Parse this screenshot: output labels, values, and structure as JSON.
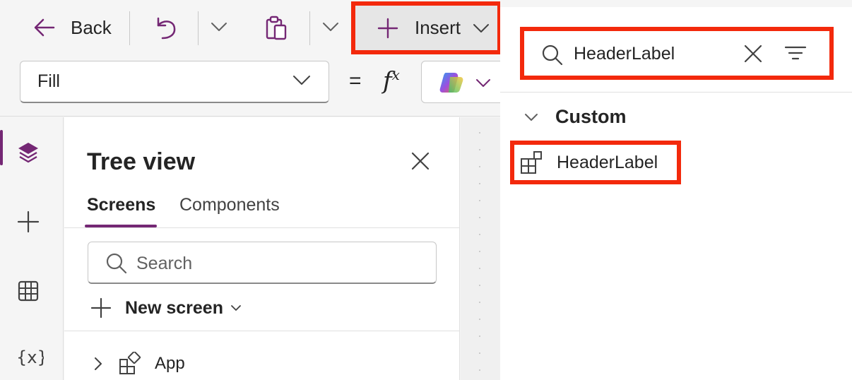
{
  "command_bar": {
    "back_label": "Back",
    "insert_label": "Insert"
  },
  "formula_bar": {
    "property": "Fill",
    "equals": "=",
    "fx": "fx"
  },
  "tree_view": {
    "title": "Tree view",
    "tabs": [
      "Screens",
      "Components"
    ],
    "search_placeholder": "Search",
    "new_screen_label": "New screen",
    "items": [
      {
        "label": "App"
      }
    ]
  },
  "insert_pane": {
    "search_value": "HeaderLabel",
    "group_label": "Custom",
    "results": [
      {
        "label": "HeaderLabel"
      }
    ]
  },
  "colors": {
    "accent": "#742774",
    "highlight": "#f3290c"
  }
}
